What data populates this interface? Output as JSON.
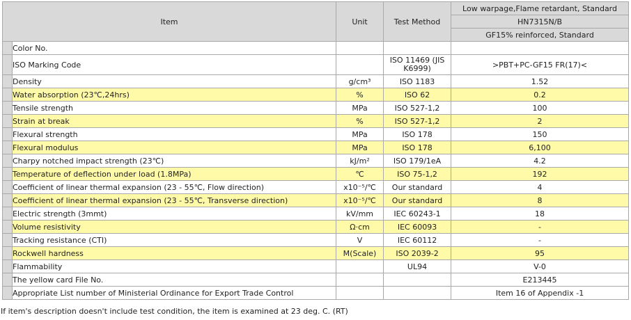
{
  "headers": {
    "item": "Item",
    "unit": "Unit",
    "test_method": "Test Method",
    "grade_desc": "Low warpage,Flame retardant, Standard",
    "grade_name": "HN7315N/B",
    "grade_sub": "GF15% reinforced, Standard"
  },
  "rows": [
    {
      "item": "Color No.",
      "unit": "",
      "method": "",
      "value": ""
    },
    {
      "item": "ISO Marking Code",
      "unit": "",
      "method": "ISO 11469 (JIS K6999)",
      "value": ">PBT+PC-GF15 FR(17)<"
    },
    {
      "item": "Density",
      "unit": "g/cm³",
      "method": "ISO 1183",
      "value": "1.52"
    },
    {
      "item": "Water absorption (23℃,24hrs)",
      "unit": "%",
      "method": "ISO 62",
      "value": "0.2"
    },
    {
      "item": "Tensile strength",
      "unit": "MPa",
      "method": "ISO 527-1,2",
      "value": "100"
    },
    {
      "item": "Strain at break",
      "unit": "%",
      "method": "ISO 527-1,2",
      "value": "2"
    },
    {
      "item": "Flexural strength",
      "unit": "MPa",
      "method": "ISO 178",
      "value": "150"
    },
    {
      "item": "Flexural modulus",
      "unit": "MPa",
      "method": "ISO 178",
      "value": "6,100"
    },
    {
      "item": "Charpy notched impact strength (23℃)",
      "unit": "kJ/m²",
      "method": "ISO 179/1eA",
      "value": "4.2"
    },
    {
      "item": "Temperature of deflection under load (1.8MPa)",
      "unit": "℃",
      "method": "ISO 75-1,2",
      "value": "192"
    },
    {
      "item": "Coefficient of linear thermal expansion (23 - 55℃, Flow direction)",
      "unit": "x10⁻⁵/℃",
      "method": "Our standard",
      "value": "4"
    },
    {
      "item": "Coefficient of linear thermal expansion (23 - 55℃, Transverse direction)",
      "unit": "x10⁻⁵/℃",
      "method": "Our standard",
      "value": "8"
    },
    {
      "item": "Electric strength (3mmt)",
      "unit": "kV/mm",
      "method": "IEC 60243-1",
      "value": "18"
    },
    {
      "item": "Volume resistivity",
      "unit": "Ω·cm",
      "method": "IEC 60093",
      "value": "-"
    },
    {
      "item": "Tracking resistance (CTI)",
      "unit": "V",
      "method": "IEC 60112",
      "value": "-"
    },
    {
      "item": "Rockwell hardness",
      "unit": "M(Scale)",
      "method": "ISO 2039-2",
      "value": "95"
    },
    {
      "item": "Flammability",
      "unit": "",
      "method": "UL94",
      "value": "V-0"
    },
    {
      "item": "The yellow card File No.",
      "unit": "",
      "method": "",
      "value": "E213445"
    },
    {
      "item": "Appropriate List number of Ministerial Ordinance for Export Trade Control",
      "unit": "",
      "method": "",
      "value": "Item 16 of Appendix -1"
    }
  ],
  "footnote": "If item's description doesn't include test condition, the item is examined at 23 deg. C. (RT)"
}
